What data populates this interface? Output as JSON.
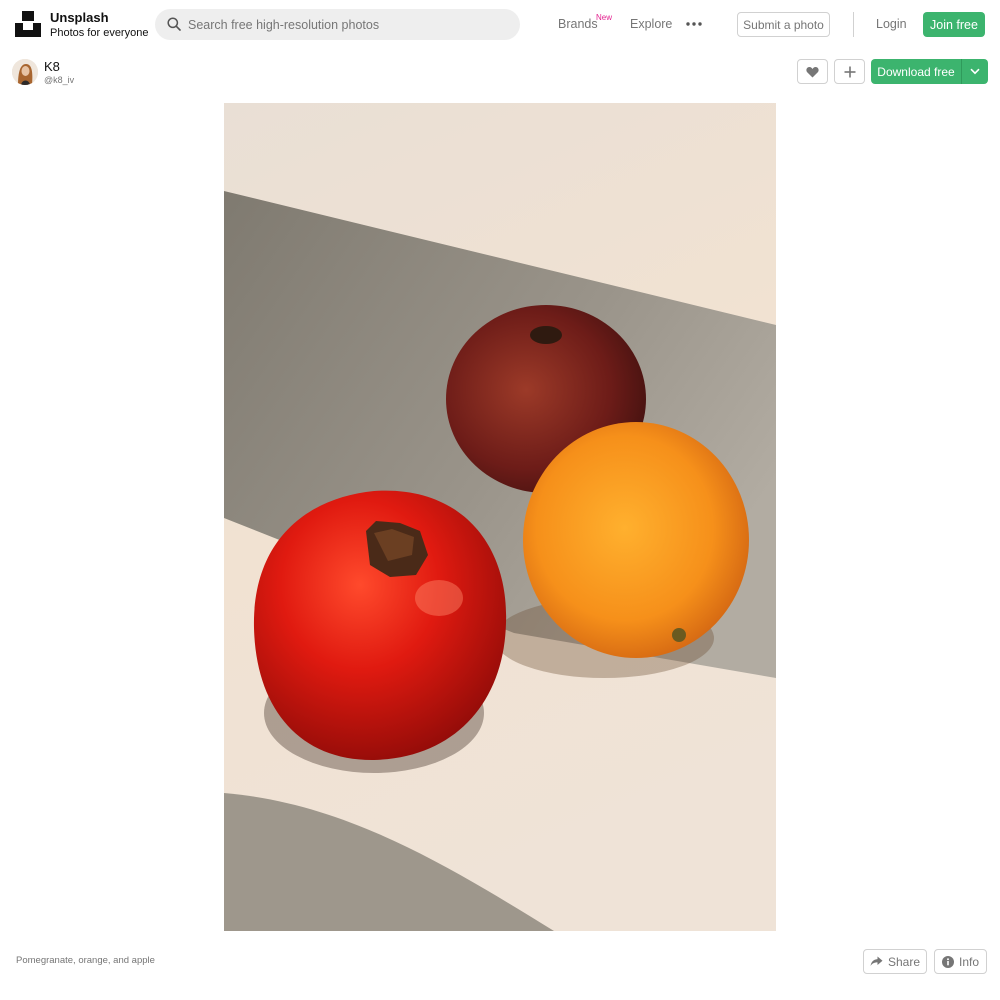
{
  "brand": {
    "name": "Unsplash",
    "tagline": "Photos for everyone"
  },
  "search": {
    "placeholder": "Search free high-resolution photos",
    "value": ""
  },
  "nav": {
    "brands": "Brands",
    "brands_badge": "New",
    "explore": "Explore",
    "more_icon": "ellipsis-icon"
  },
  "actions": {
    "submit": "Submit a photo",
    "login": "Login",
    "join": "Join free"
  },
  "author": {
    "name": "K8",
    "handle": "@k8_iv"
  },
  "photo_actions": {
    "like_icon": "heart-icon",
    "add_icon": "plus-icon",
    "download": "Download free",
    "download_menu_icon": "chevron-down-icon"
  },
  "photo": {
    "alt": "Pomegranate, orange, and apple"
  },
  "footer": {
    "caption": "Pomegranate, orange, and apple",
    "share": "Share",
    "info": "Info"
  },
  "colors": {
    "accent_green": "#3cb46e",
    "new_badge_pink": "#e3218f",
    "muted_text": "#767676",
    "border": "#d1d1d1"
  }
}
